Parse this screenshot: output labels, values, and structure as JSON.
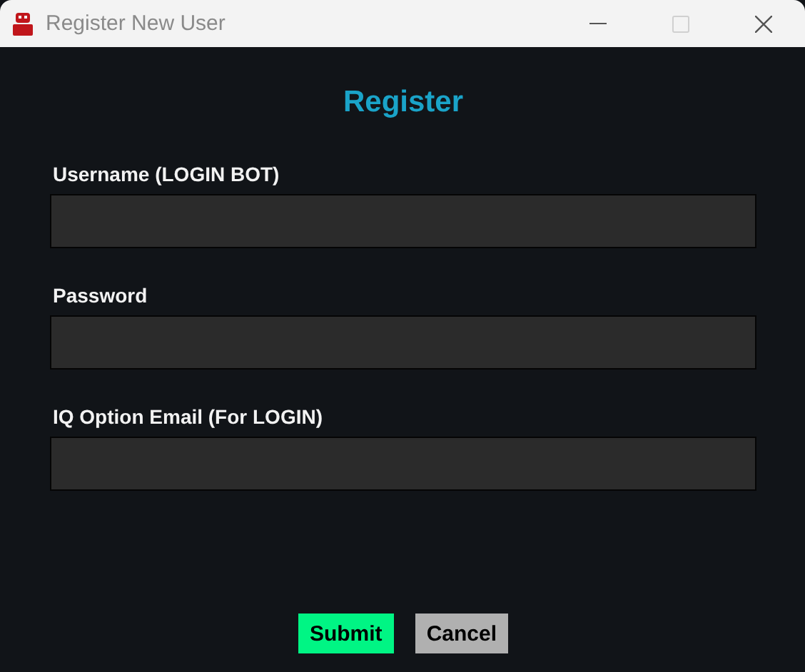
{
  "window": {
    "title": "Register New User",
    "maximize_disabled": true
  },
  "heading": "Register",
  "fields": [
    {
      "label": "Username (LOGIN BOT)"
    },
    {
      "label": "Password"
    },
    {
      "label": "IQ Option Email (For LOGIN)"
    }
  ],
  "buttons": [
    {
      "label": "Submit",
      "kind": "primary"
    },
    {
      "label": "Cancel",
      "kind": "secondary"
    }
  ]
}
